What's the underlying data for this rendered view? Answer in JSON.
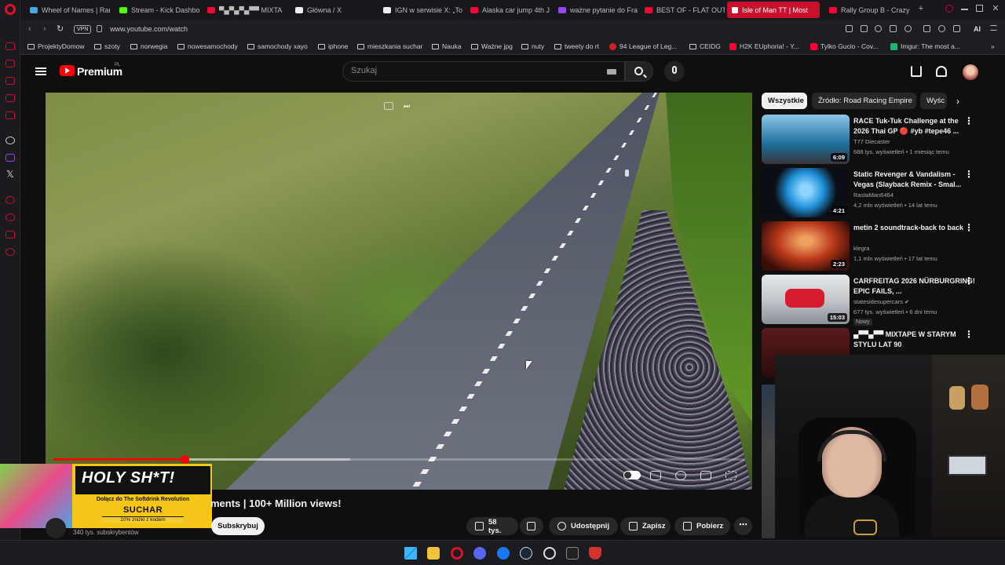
{
  "browser": {
    "tabs": [
      {
        "label": "Wheel of Names | Ran",
        "color": "#4aa5e8"
      },
      {
        "label": "Stream - Kick Dashbo",
        "color": "#53fc18"
      },
      {
        "label": "▀▄▀▄▀▄▀▀ MIXTA",
        "color": "#ff0033"
      },
      {
        "label": "Główna / X",
        "color": "#eeeeee"
      },
      {
        "label": "IGN w serwisie X: „To",
        "color": "#eeeeee"
      },
      {
        "label": "Alaska car jump 4th J",
        "color": "#ff0033"
      },
      {
        "label": "ważne pytanie do Fra",
        "color": "#9146ff"
      },
      {
        "label": "BEST OF - FLAT OUT",
        "color": "#ff0033"
      },
      {
        "label": "Isle of Man TT | Most",
        "color": "#ffffff",
        "active": true
      },
      {
        "label": "Rally Group B - Crazy",
        "color": "#ff0033"
      }
    ],
    "new_tab": "+",
    "url": "www.youtube.com/watch",
    "vpn_label": "VPN",
    "ai_label": "AI",
    "bookmarks": [
      {
        "label": "ProjektyDomow",
        "type": "folder"
      },
      {
        "label": "szoty",
        "type": "folder"
      },
      {
        "label": "norwegia",
        "type": "folder"
      },
      {
        "label": "nowesamochody",
        "type": "folder"
      },
      {
        "label": "samochody xayo",
        "type": "folder"
      },
      {
        "label": "iphone",
        "type": "folder"
      },
      {
        "label": "mieszkania suchar",
        "type": "folder"
      },
      {
        "label": "Nauka",
        "type": "folder"
      },
      {
        "label": "Ważne jpg",
        "type": "folder"
      },
      {
        "label": "nuty",
        "type": "folder"
      },
      {
        "label": "tweety do rt",
        "type": "folder"
      },
      {
        "label": "94 League of Leg...",
        "type": "site",
        "color": "#d02020"
      },
      {
        "label": "CEIDG",
        "type": "folder"
      },
      {
        "label": "H2K EUphoria! - Y...",
        "type": "site",
        "color": "#ff0033"
      },
      {
        "label": "Tylko Gucio - Cov...",
        "type": "site",
        "color": "#ff0033"
      },
      {
        "label": "Imgur: The most a...",
        "type": "site",
        "color": "#1bb76e"
      }
    ]
  },
  "youtube": {
    "brand": "Premium",
    "brand_region": "PL",
    "search_placeholder": "Szukaj",
    "player": {
      "progress_played": 0.19,
      "progress_buffered": 0.43
    },
    "video_title": "ments | 100+ Million views!",
    "subscriber_count": "340 tys. subskrybentów",
    "subscribe_label": "Subskrybuj",
    "likes": "58 tys.",
    "share_label": "Udostępnij",
    "save_label": "Zapisz",
    "download_label": "Pobierz",
    "chips": [
      {
        "label": "Wszystkie",
        "selected": true
      },
      {
        "label": "Źródło: Road Racing Empire",
        "selected": false
      },
      {
        "label": "Wyśc",
        "selected": false
      }
    ],
    "recommendations": [
      {
        "title": "RACE Tuk-Tuk Challenge at the 2026 Thai GP 🔴 #yb #tepe46 ...",
        "channel": "T77 Diecaster",
        "meta": "688 tys. wyświetleń • 1 miesiąc temu",
        "duration": "6:09",
        "thumb": "#1c6e9a"
      },
      {
        "title": "Static Revenger & Vandalism - Vegas (Slayback Remix - Smal...",
        "channel": "RastaMan6464",
        "meta": "4,2 mln wyświetleń • 14 lat temu",
        "duration": "4:21",
        "thumb": "#1e8fd6"
      },
      {
        "title": "metin 2 soundtrack-back to back",
        "channel": "klegra",
        "meta": "1,1 mln wyświetleń • 17 lat temu",
        "duration": "2:23",
        "thumb": "#b8381a"
      },
      {
        "title": "CARFREITAG 2026 NÜRBURGRING! EPIC FAILS, ...",
        "channel": "statesidesupercars ✔",
        "meta": "677 tys. wyświetleń • 6 dni temu",
        "duration": "15:03",
        "badge": "Nowy",
        "thumb": "#c2c7cc"
      },
      {
        "title": "▄▀▀▄▀▀ MIXTAPE W STARYM STYLU LAT 90",
        "channel": "",
        "meta": "",
        "duration": "",
        "thumb": "#5a1a1a"
      }
    ]
  },
  "ad": {
    "title": "HOLY SH*T!",
    "line": "Dołącz do The Softdrink Revolution",
    "brand": "SUCHAR",
    "promo": "10% zniżki z kodem"
  }
}
